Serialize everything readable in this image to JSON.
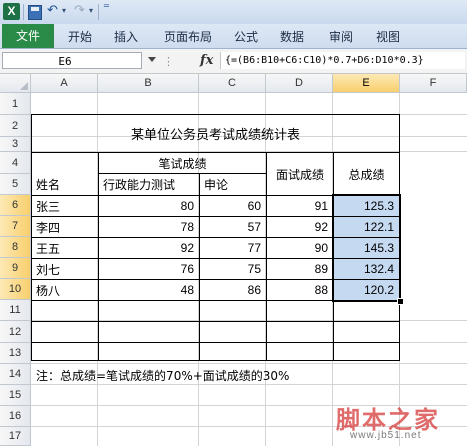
{
  "app": {
    "icon_letter": "X"
  },
  "quick_access": {
    "save_icon": "save-icon",
    "undo_glyph": "↶",
    "redo_glyph": "↷",
    "menu_glyph": "▾",
    "customize_glyph": "⁼"
  },
  "ribbon": {
    "tabs": [
      "文件",
      "开始",
      "插入",
      "页面布局",
      "公式",
      "数据",
      "审阅",
      "视图"
    ],
    "file_tab_color": "#2a8a47"
  },
  "formula_bar": {
    "name_box": "E6",
    "fx_label": "fx",
    "formula": "{=(B6:B10+C6:C10)*0.7+D6:D10*0.3}"
  },
  "sheet": {
    "columns": [
      "A",
      "B",
      "C",
      "D",
      "E",
      "F"
    ],
    "selected_column": "E",
    "rows": [
      "1",
      "2",
      "3",
      "4",
      "5",
      "6",
      "7",
      "8",
      "9",
      "10",
      "11",
      "12",
      "13",
      "14",
      "15",
      "16",
      "17"
    ],
    "title": "某单位公务员考试成绩统计表",
    "headers": {
      "written": "笔试成绩",
      "interview": "面试成绩",
      "total": "总成绩",
      "name": "姓名",
      "admin": "行政能力测试",
      "essay": "申论"
    },
    "records": [
      {
        "name": "张三",
        "admin": "80",
        "essay": "60",
        "interview": "91",
        "total": "125.3"
      },
      {
        "name": "李四",
        "admin": "78",
        "essay": "57",
        "interview": "92",
        "total": "122.1"
      },
      {
        "name": "王五",
        "admin": "92",
        "essay": "77",
        "interview": "90",
        "total": "145.3"
      },
      {
        "name": "刘七",
        "admin": "76",
        "essay": "75",
        "interview": "89",
        "total": "132.4"
      },
      {
        "name": "杨八",
        "admin": "48",
        "essay": "86",
        "interview": "88",
        "total": "120.2"
      }
    ],
    "note": "注：总成绩=笔试成绩的70%+面试成绩的30%",
    "highlight_color": "#c5d9f1"
  },
  "watermark": {
    "text": "脚本之家",
    "sub": "www.jb51.net"
  }
}
